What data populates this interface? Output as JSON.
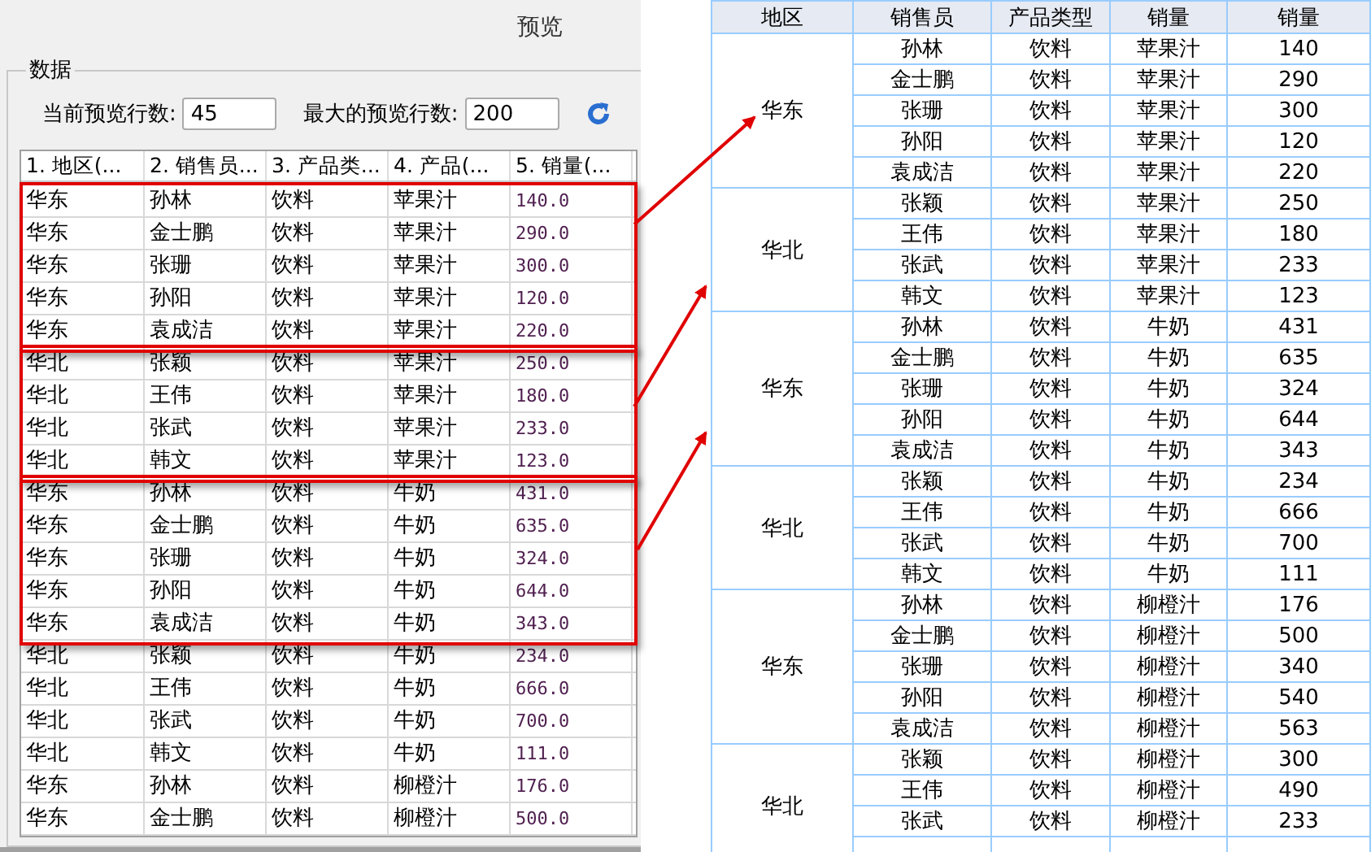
{
  "preview_panel": {
    "title": "预览",
    "group_title": "数据",
    "current_rows_label": "当前预览行数:",
    "current_rows_value": "45",
    "max_rows_label": "最大的预览行数:",
    "max_rows_value": "200"
  },
  "left_table": {
    "columns": [
      "1. 地区(...",
      "2. 销售员...",
      "3. 产品类...",
      "4. 产品(...",
      "5. 销量(..."
    ],
    "row_groups": [
      {
        "highlighted": true,
        "rows": [
          [
            "华东",
            "孙林",
            "饮料",
            "苹果汁",
            "140.0"
          ],
          [
            "华东",
            "金士鹏",
            "饮料",
            "苹果汁",
            "290.0"
          ],
          [
            "华东",
            "张珊",
            "饮料",
            "苹果汁",
            "300.0"
          ],
          [
            "华东",
            "孙阳",
            "饮料",
            "苹果汁",
            "120.0"
          ],
          [
            "华东",
            "袁成洁",
            "饮料",
            "苹果汁",
            "220.0"
          ]
        ]
      },
      {
        "highlighted": true,
        "rows": [
          [
            "华北",
            "张颖",
            "饮料",
            "苹果汁",
            "250.0"
          ],
          [
            "华北",
            "王伟",
            "饮料",
            "苹果汁",
            "180.0"
          ],
          [
            "华北",
            "张武",
            "饮料",
            "苹果汁",
            "233.0"
          ],
          [
            "华北",
            "韩文",
            "饮料",
            "苹果汁",
            "123.0"
          ]
        ]
      },
      {
        "highlighted": true,
        "rows": [
          [
            "华东",
            "孙林",
            "饮料",
            "牛奶",
            "431.0"
          ],
          [
            "华东",
            "金士鹏",
            "饮料",
            "牛奶",
            "635.0"
          ],
          [
            "华东",
            "张珊",
            "饮料",
            "牛奶",
            "324.0"
          ],
          [
            "华东",
            "孙阳",
            "饮料",
            "牛奶",
            "644.0"
          ],
          [
            "华东",
            "袁成洁",
            "饮料",
            "牛奶",
            "343.0"
          ]
        ]
      },
      {
        "highlighted": false,
        "rows": [
          [
            "华北",
            "张颖",
            "饮料",
            "牛奶",
            "234.0"
          ],
          [
            "华北",
            "王伟",
            "饮料",
            "牛奶",
            "666.0"
          ],
          [
            "华北",
            "张武",
            "饮料",
            "牛奶",
            "700.0"
          ],
          [
            "华北",
            "韩文",
            "饮料",
            "牛奶",
            "111.0"
          ],
          [
            "华东",
            "孙林",
            "饮料",
            "柳橙汁",
            "176.0"
          ],
          [
            "华东",
            "金士鹏",
            "饮料",
            "柳橙汁",
            "500.0"
          ]
        ]
      }
    ]
  },
  "right_table": {
    "columns": [
      "地区",
      "销售员",
      "产品类型",
      "销量",
      "销量"
    ],
    "groups": [
      {
        "region": "华东",
        "rows": [
          [
            "孙林",
            "饮料",
            "苹果汁",
            "140"
          ],
          [
            "金士鹏",
            "饮料",
            "苹果汁",
            "290"
          ],
          [
            "张珊",
            "饮料",
            "苹果汁",
            "300"
          ],
          [
            "孙阳",
            "饮料",
            "苹果汁",
            "120"
          ],
          [
            "袁成洁",
            "饮料",
            "苹果汁",
            "220"
          ]
        ]
      },
      {
        "region": "华北",
        "rows": [
          [
            "张颖",
            "饮料",
            "苹果汁",
            "250"
          ],
          [
            "王伟",
            "饮料",
            "苹果汁",
            "180"
          ],
          [
            "张武",
            "饮料",
            "苹果汁",
            "233"
          ],
          [
            "韩文",
            "饮料",
            "苹果汁",
            "123"
          ]
        ]
      },
      {
        "region": "华东",
        "rows": [
          [
            "孙林",
            "饮料",
            "牛奶",
            "431"
          ],
          [
            "金士鹏",
            "饮料",
            "牛奶",
            "635"
          ],
          [
            "张珊",
            "饮料",
            "牛奶",
            "324"
          ],
          [
            "孙阳",
            "饮料",
            "牛奶",
            "644"
          ],
          [
            "袁成洁",
            "饮料",
            "牛奶",
            "343"
          ]
        ]
      },
      {
        "region": "华北",
        "rows": [
          [
            "张颖",
            "饮料",
            "牛奶",
            "234"
          ],
          [
            "王伟",
            "饮料",
            "牛奶",
            "666"
          ],
          [
            "张武",
            "饮料",
            "牛奶",
            "700"
          ],
          [
            "韩文",
            "饮料",
            "牛奶",
            "111"
          ]
        ]
      },
      {
        "region": "华东",
        "rows": [
          [
            "孙林",
            "饮料",
            "柳橙汁",
            "176"
          ],
          [
            "金士鹏",
            "饮料",
            "柳橙汁",
            "500"
          ],
          [
            "张珊",
            "饮料",
            "柳橙汁",
            "340"
          ],
          [
            "孙阳",
            "饮料",
            "柳橙汁",
            "540"
          ],
          [
            "袁成洁",
            "饮料",
            "柳橙汁",
            "563"
          ]
        ]
      },
      {
        "region": "华北",
        "rows": [
          [
            "张颖",
            "饮料",
            "柳橙汁",
            "300"
          ],
          [
            "王伟",
            "饮料",
            "柳橙汁",
            "490"
          ],
          [
            "张武",
            "饮料",
            "柳橙汁",
            "233"
          ]
        ]
      }
    ]
  }
}
